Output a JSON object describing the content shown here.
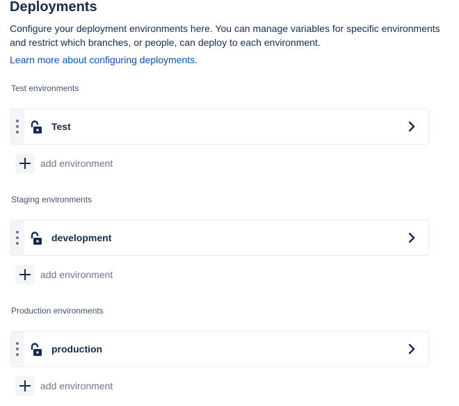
{
  "header": {
    "title": "Deployments",
    "description": "Configure your deployment environments here. You can manage variables for specific environments and restrict which branches, or people, can deploy to each environment.",
    "learn_more": "Learn more about configuring deployments",
    "learn_more_tail": "."
  },
  "sections": [
    {
      "heading": "Test environments",
      "environment": {
        "name": "Test",
        "icon": "unlocked-padlock-icon"
      },
      "add_label": "add environment"
    },
    {
      "heading": "Staging environments",
      "environment": {
        "name": "development",
        "icon": "unlocked-padlock-icon"
      },
      "add_label": "add environment"
    },
    {
      "heading": "Production environments",
      "environment": {
        "name": "production",
        "icon": "unlocked-padlock-icon"
      },
      "add_label": "add environment"
    }
  ],
  "colors": {
    "text": "#172B4D",
    "link": "#0052CC",
    "muted": "#6B778C",
    "border": "#EBECF0"
  }
}
